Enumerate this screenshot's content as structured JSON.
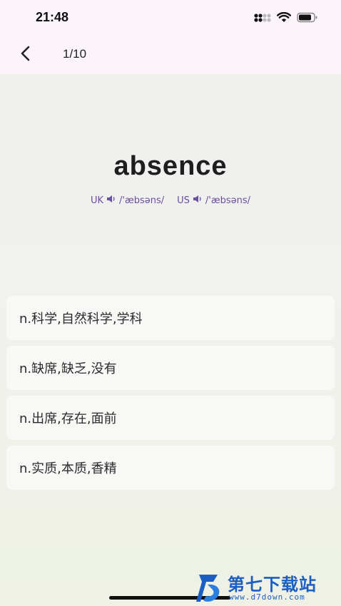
{
  "status_bar": {
    "time": "21:48",
    "icons": [
      "cellular-signal-icon",
      "wifi-icon",
      "battery-icon"
    ]
  },
  "nav": {
    "progress": "1/10"
  },
  "card": {
    "word": "absence",
    "phonetics": [
      {
        "region": "UK",
        "ipa": "/'æbsəns/"
      },
      {
        "region": "US",
        "ipa": "/'æbsəns/"
      }
    ]
  },
  "options": [
    {
      "label": "n.科学,自然科学,学科"
    },
    {
      "label": "n.缺席,缺乏,没有"
    },
    {
      "label": "n.出席,存在,面前"
    },
    {
      "label": "n.实质,本质,香精"
    }
  ],
  "watermark": {
    "title": "第七下载站",
    "url": "www.d7down.com"
  },
  "colors": {
    "accent": "#6a4fa0",
    "header_bg": "#fbf4fb",
    "watermark": "#1c5fc2"
  }
}
